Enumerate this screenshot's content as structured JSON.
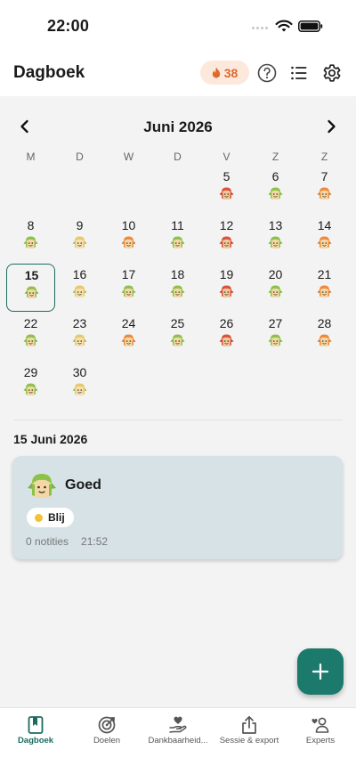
{
  "status_bar": {
    "time": "22:00"
  },
  "header": {
    "title": "Dagboek",
    "streak_count": "38"
  },
  "calendar": {
    "month_label": "Juni 2026",
    "weekdays": [
      "M",
      "D",
      "W",
      "D",
      "V",
      "Z",
      "Z"
    ],
    "days": [
      {
        "n": "",
        "mood": null
      },
      {
        "n": "",
        "mood": null
      },
      {
        "n": "",
        "mood": null
      },
      {
        "n": "",
        "mood": null
      },
      {
        "n": "5",
        "mood": "red"
      },
      {
        "n": "6",
        "mood": "green"
      },
      {
        "n": "7",
        "mood": "orange"
      },
      {
        "n": "8",
        "mood": "green"
      },
      {
        "n": "9",
        "mood": "yellow"
      },
      {
        "n": "10",
        "mood": "orange"
      },
      {
        "n": "11",
        "mood": "green"
      },
      {
        "n": "12",
        "mood": "red"
      },
      {
        "n": "13",
        "mood": "green"
      },
      {
        "n": "14",
        "mood": "orange"
      },
      {
        "n": "15",
        "mood": "green"
      },
      {
        "n": "16",
        "mood": "yellow"
      },
      {
        "n": "17",
        "mood": "green"
      },
      {
        "n": "18",
        "mood": "green"
      },
      {
        "n": "19",
        "mood": "red"
      },
      {
        "n": "20",
        "mood": "green"
      },
      {
        "n": "21",
        "mood": "orange"
      },
      {
        "n": "22",
        "mood": "green"
      },
      {
        "n": "23",
        "mood": "yellow"
      },
      {
        "n": "24",
        "mood": "orange"
      },
      {
        "n": "25",
        "mood": "green"
      },
      {
        "n": "26",
        "mood": "red"
      },
      {
        "n": "27",
        "mood": "green"
      },
      {
        "n": "28",
        "mood": "orange"
      },
      {
        "n": "29",
        "mood": "green"
      },
      {
        "n": "30",
        "mood": "yellow"
      }
    ],
    "selected_day": "15"
  },
  "entry": {
    "date_label": "15 Juni 2026",
    "mood_label": "Goed",
    "tag": "Blij",
    "notes": "0 notities",
    "time": "21:52"
  },
  "tabs": [
    {
      "label": "Dagboek",
      "icon": "book-icon",
      "active": true
    },
    {
      "label": "Doelen",
      "icon": "target-icon",
      "active": false
    },
    {
      "label": "Dankbaarheid...",
      "icon": "heart-hand-icon",
      "active": false
    },
    {
      "label": "Sessie & export",
      "icon": "share-icon",
      "active": false
    },
    {
      "label": "Experts",
      "icon": "experts-icon",
      "active": false
    }
  ],
  "colors": {
    "accent": "#1c7a6c",
    "streak_bg": "#fde8dc",
    "streak_text": "#dc6a2e",
    "card_bg": "#d7e2e6",
    "mood_green": "#8bc34a",
    "mood_orange": "#ef8a3c",
    "mood_red": "#d9533f",
    "mood_yellow": "#e8c86a"
  }
}
